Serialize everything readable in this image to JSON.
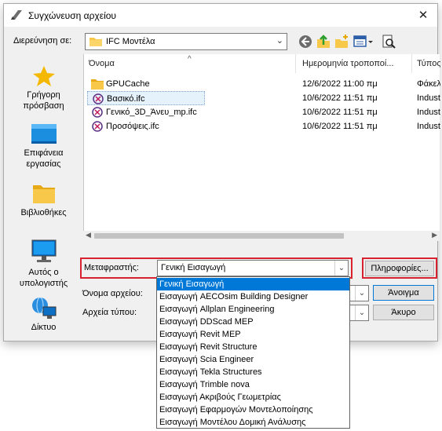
{
  "window": {
    "title": "Συγχώνευση αρχείου",
    "close_glyph": "✕"
  },
  "lookin": {
    "label": "Διερεύνηση σε:",
    "value": "IFC Μοντέλα"
  },
  "toolbar": {
    "icons": [
      "back-icon",
      "up-folder-icon",
      "new-folder-icon",
      "view-menu-icon",
      "preview-icon"
    ]
  },
  "places": [
    {
      "label_1": "Γρήγορη",
      "label_2": "πρόσβαση",
      "icon": "star-icon"
    },
    {
      "label_1": "Επιφάνεια",
      "label_2": "εργασίας",
      "icon": "desktop-icon"
    },
    {
      "label_1": "Βιβλιοθήκες",
      "label_2": "",
      "icon": "library-icon"
    },
    {
      "label_1": "Αυτός ο",
      "label_2": "υπολογιστής",
      "icon": "computer-icon"
    },
    {
      "label_1": "Δίκτυο",
      "label_2": "",
      "icon": "network-icon"
    }
  ],
  "columns": {
    "name": "Όνομα",
    "date": "Ημερομηνία τροποποί...",
    "type": "Τύπος"
  },
  "files": [
    {
      "name": "GPUCache",
      "date": "12/6/2022 11:00 πμ",
      "type": "Φάκελ",
      "icon": "folder-icon"
    },
    {
      "name": "Βασικό.ifc",
      "date": "10/6/2022 11:51 πμ",
      "type": "Indust",
      "icon": "ifc-file-icon"
    },
    {
      "name": "Γενικό_3D_Άνευ_mp.ifc",
      "date": "10/6/2022 11:51 πμ",
      "type": "Indust",
      "icon": "ifc-file-icon"
    },
    {
      "name": "Προσόψεις.ifc",
      "date": "10/6/2022 11:51 πμ",
      "type": "Indust",
      "icon": "ifc-file-icon"
    }
  ],
  "translator": {
    "label": "Μεταφραστής:",
    "value": "Γενική Εισαγωγή",
    "info_button": "Πληροφορίες..."
  },
  "filename": {
    "label": "Όνομα αρχείου:",
    "value": "",
    "open_button": "Άνοιγμα"
  },
  "filetype": {
    "label": "Αρχεία τύπου:",
    "value": "",
    "cancel_button": "Άκυρο"
  },
  "dropdown_options": [
    "Γενική Εισαγωγή",
    "Εισαγωγή AECOsim Building Designer",
    "Εισαγωγή Allplan Engineering",
    "Εισαγωγή DDScad MEP",
    "Εισαγωγή Revit MEP",
    "Εισαγωγή Revit Structure",
    "Εισαγωγή Scia Engineer",
    "Εισαγωγή Tekla Structures",
    "Εισαγωγή Trimble nova",
    "Εισαγωγή Ακριβούς Γεωμετρίας",
    "Εισαγωγή Εφαρμογών Μοντελοποίησης",
    "Εισαγωγή Μοντέλου Δομική Ανάλυσης"
  ],
  "colors": {
    "accent": "#0078d7",
    "highlight_border": "#d9222f",
    "folder": "#f8c84a"
  }
}
